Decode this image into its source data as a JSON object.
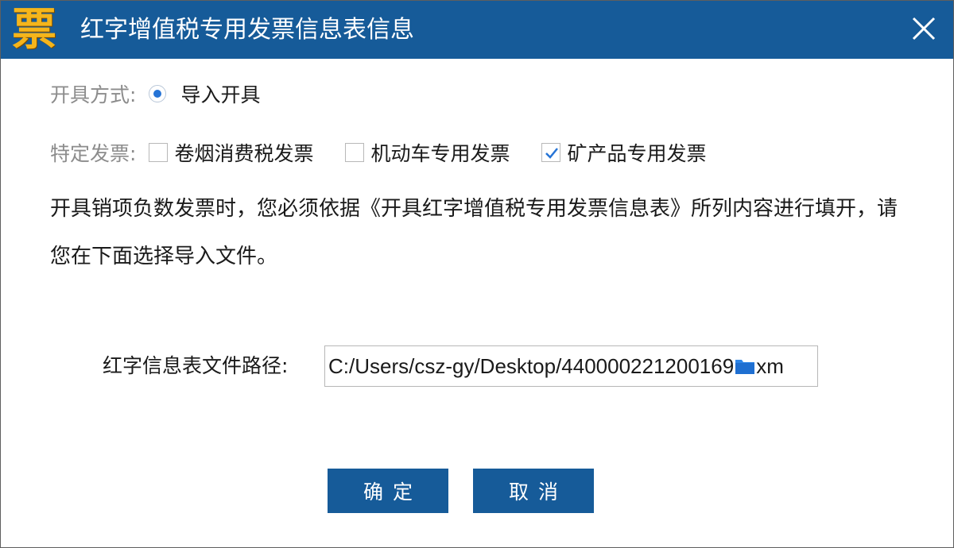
{
  "window": {
    "icon_char": "票",
    "title": "红字增值税专用发票信息表信息",
    "close_symbol": "✕"
  },
  "issue_mode": {
    "label": "开具方式:",
    "option_label": "导入开具",
    "selected": true
  },
  "special_invoice": {
    "label": "特定发票:",
    "options": [
      {
        "label": "卷烟消费税发票",
        "checked": false
      },
      {
        "label": "机动车专用发票",
        "checked": false
      },
      {
        "label": "矿产品专用发票",
        "checked": true
      }
    ]
  },
  "instruction": "开具销项负数发票时，您必须依据《开具红字增值税专用发票信息表》所列内容进行填开，请您在下面选择导入文件。",
  "file_path": {
    "label": "红字信息表文件路径:",
    "value_prefix": "C:/Users/csz-gy/Desktop/440000221200169",
    "value_suffix": "xm"
  },
  "buttons": {
    "ok": "确定",
    "cancel": "取消"
  },
  "colors": {
    "titlebar": "#165b99",
    "button": "#165b99",
    "radio_dot": "#2674d6",
    "check": "#2674d6",
    "icon": "#f5b51b"
  }
}
